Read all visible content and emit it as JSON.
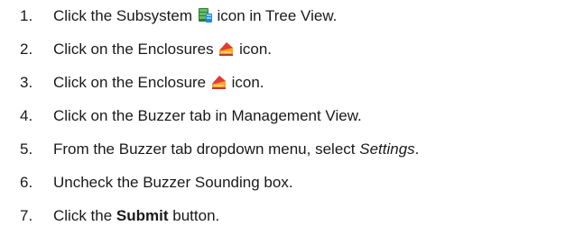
{
  "steps": [
    {
      "number": "1.",
      "before": "Click the Subsystem ",
      "icon": "subsystem-icon",
      "after": " icon in Tree View."
    },
    {
      "number": "2.",
      "before": "Click on the Enclosures ",
      "icon": "enclosures-icon",
      "after": " icon."
    },
    {
      "number": "3.",
      "before": "Click on the Enclosure ",
      "icon": "enclosure-icon",
      "after": " icon."
    },
    {
      "number": "4.",
      "text": "Click on the Buzzer tab in Management View."
    },
    {
      "number": "5.",
      "before": "From the Buzzer tab dropdown menu, select ",
      "italic": "Settings",
      "after": "."
    },
    {
      "number": "6.",
      "text": "Uncheck the Buzzer Sounding box."
    },
    {
      "number": "7.",
      "before": "Click the ",
      "bold": "Submit",
      "after": " button."
    }
  ]
}
